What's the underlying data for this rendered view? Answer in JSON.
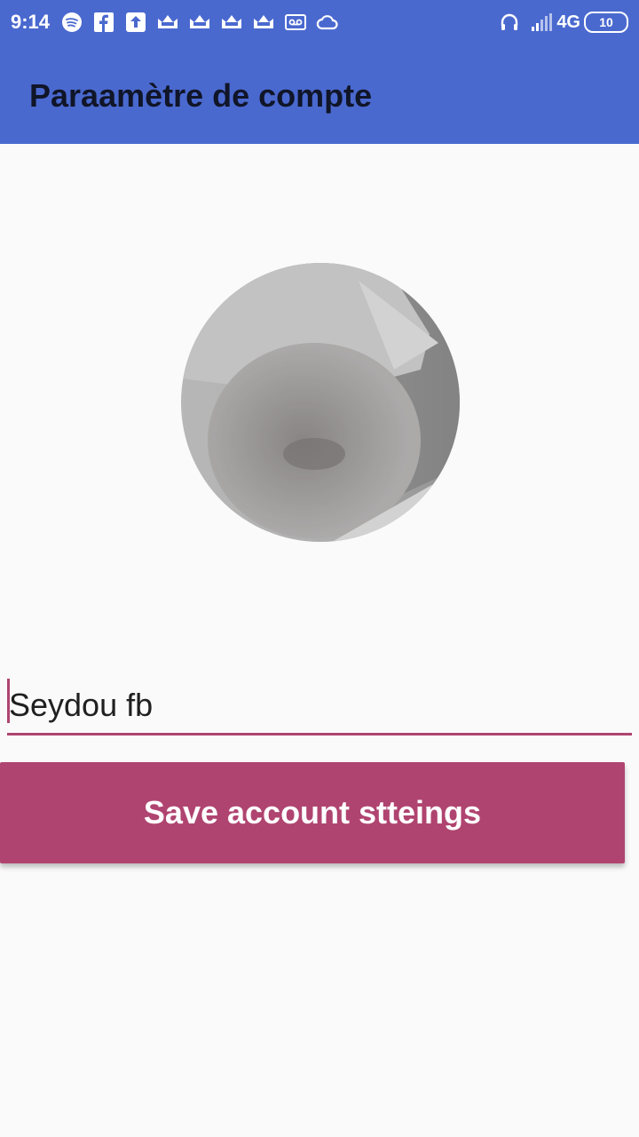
{
  "status_bar": {
    "time": "9:14",
    "network": "4G",
    "battery": "10",
    "left_icons": [
      "spotify-icon",
      "facebook-icon",
      "upload-icon",
      "crown-app-icon",
      "crown-app-icon",
      "crown-app-icon",
      "crown-app-icon",
      "voicemail-icon",
      "cloud-icon"
    ],
    "right_icons": [
      "headphones-icon",
      "signal-icon",
      "battery-icon"
    ],
    "background": "#4a69cf"
  },
  "toolbar": {
    "title": "Paraamètre de compte"
  },
  "profile": {
    "avatar": "profile-photo"
  },
  "name_field": {
    "value": "Seydou fb",
    "accent": "#b04470"
  },
  "save_button": {
    "label": "Save account stteings",
    "color": "#b04470"
  }
}
